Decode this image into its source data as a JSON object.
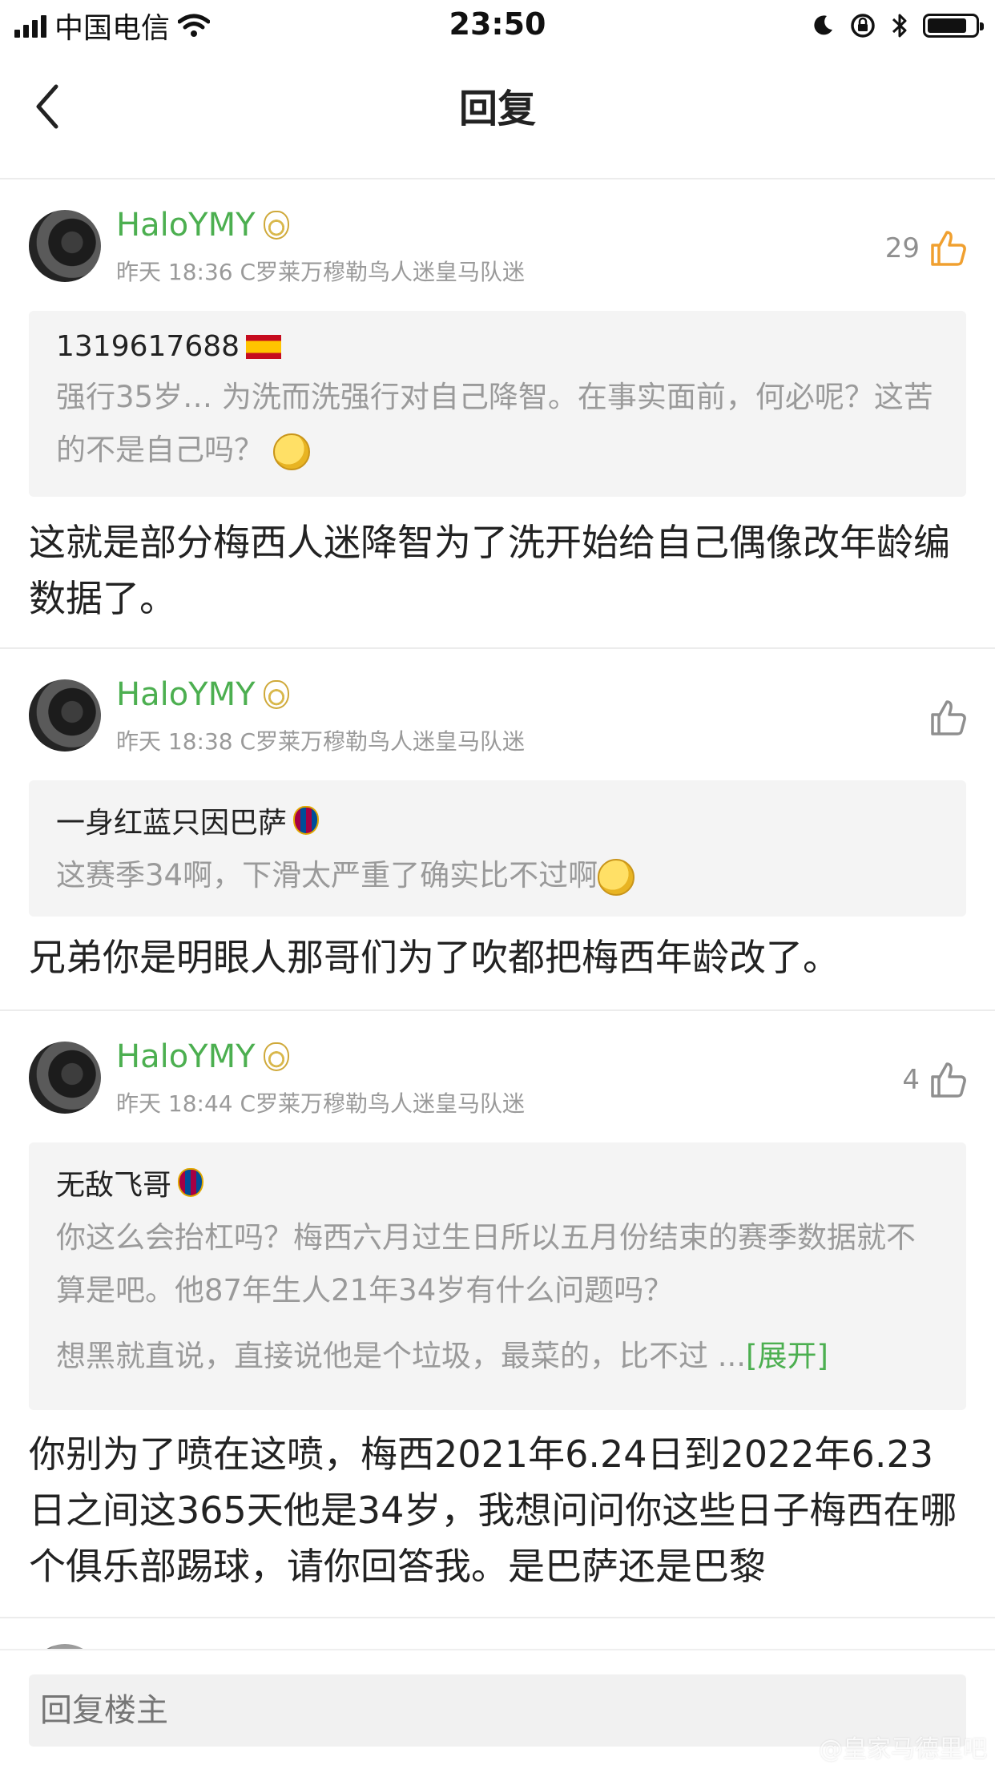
{
  "status_bar": {
    "carrier": "中国电信",
    "time": "23:50"
  },
  "nav": {
    "title": "回复"
  },
  "posts": [
    {
      "username": "HaloYMY",
      "meta": "昨天 18:36 C罗莱万穆勒鸟人迷皇马队迷",
      "likes": "29",
      "quote_user": "1319617688",
      "quote_text": "强行35岁… 为洗而洗强行对自己降智。在事实面前，何必呢？这苦的不是自己吗？",
      "body": "这就是部分梅西人迷降智为了洗开始给自己偶像改年龄编数据了。"
    },
    {
      "username": "HaloYMY",
      "meta": "昨天 18:38 C罗莱万穆勒鸟人迷皇马队迷",
      "likes": "",
      "quote_user": "一身红蓝只因巴萨",
      "quote_text": "这赛季34啊，下滑太严重了确实比不过啊",
      "body": "兄弟你是明眼人那哥们为了吹都把梅西年龄改了。"
    },
    {
      "username": "HaloYMY",
      "meta": "昨天 18:44 C罗莱万穆勒鸟人迷皇马队迷",
      "likes": "4",
      "quote_user": "无敌飞哥",
      "quote_text": "你这么会抬杠吗？梅西六月过生日所以五月份结束的赛季数据就不算是吧。他87年生人21年34岁有什么问题吗？",
      "quote_text_2": "想黑就直说，直接说他是个垃圾，最菜的，比不过 ...",
      "expand_label": "[展开]",
      "body": "你别为了喷在这喷，梅西2021年6.24日到2022年6.23日之间这365天他是34岁，我想问问你这些日子梅西在哪个俱乐部踢球，请你回答我。是巴萨还是巴黎"
    }
  ],
  "reply_box": {
    "placeholder": "回复楼主"
  },
  "watermark": "@皇家马德里吧",
  "colors": {
    "username": "#4caf50",
    "meta": "#9a9a9a",
    "quote_bg": "#f4f4f4",
    "like_active": "#f0a030",
    "like_inactive": "#8f8f8f"
  },
  "icons": {
    "back": "chevron-left-icon",
    "like": "thumbs-up-icon",
    "team_badge_user": "real-madrid-crest-icon",
    "team_badge_fcb": "barcelona-crest-icon",
    "flag": "spain-flag-icon"
  }
}
